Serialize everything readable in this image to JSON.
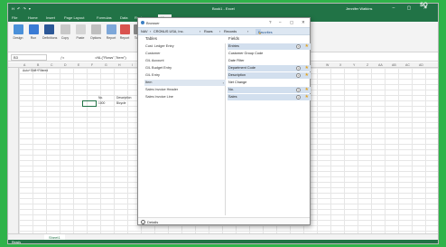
{
  "excel": {
    "title_doc": "Book1 - Excel",
    "title_user": "Jennifer Watkins",
    "quick_access": "H ↶ ↷ ▾",
    "window_controls": "– ▢ ✕",
    "tabs": [
      "File",
      "Home",
      "Insert",
      "Page Layout",
      "Formulas",
      "Data",
      "Review",
      "View"
    ],
    "ribbon_buttons": [
      "Design",
      "Run",
      "Definitions",
      "Copy",
      "Paste",
      "Options",
      "Report",
      "Report",
      "Tools"
    ],
    "name_box": "B3",
    "formula": "=NL(\"Rows\",\"Item\")",
    "columns": [
      "A",
      "B",
      "C",
      "D",
      "E",
      "F",
      "G",
      "H",
      "I",
      "J",
      "K",
      "L",
      "M",
      "N",
      "O",
      "P",
      "Q",
      "R",
      "S",
      "T",
      "U",
      "V",
      "W",
      "X",
      "Y",
      "Z",
      "AA",
      "AB",
      "AC",
      "AD",
      "AE"
    ],
    "cells": [
      {
        "text": "Auto+Shift+Filtered",
        "row": "r1a"
      },
      {
        "text": "No.",
        "row": "r2"
      },
      {
        "text": "Description",
        "row": "r2b"
      },
      {
        "text": "1000",
        "row": "r3"
      },
      {
        "text": "Bicycle",
        "row": "r3b"
      }
    ],
    "sheet_tab": "Sheet1",
    "status": "Ready"
  },
  "dialog": {
    "title": "Browser",
    "controls": [
      "?",
      "–",
      "▢",
      "✕"
    ],
    "crumbs": [
      "NAV",
      "CRONUS USA, Inc.",
      "Rows",
      "Records"
    ],
    "favorites_label": "Favorites",
    "tables_header": "Tables",
    "fields_header": "Fields",
    "tables": [
      "Cust. Ledger Entry",
      "Customer",
      "G/L Account",
      "G/L Budget Entry",
      "G/L Entry",
      "Item",
      "Sales Invoice Header",
      "Sales Invoice Line"
    ],
    "selected_table_index": 5,
    "fields": [
      {
        "label": "Entries",
        "badge": "",
        "highlight": true,
        "circle": "+",
        "star": true
      },
      {
        "label": "Customer Group Code",
        "badge": "",
        "highlight": false,
        "circle": "",
        "star": false
      },
      {
        "label": "Date Filter",
        "badge": "",
        "highlight": false,
        "circle": "",
        "star": false
      },
      {
        "label": "Department Code",
        "badge": "",
        "highlight": true,
        "circle": "+",
        "star": true
      },
      {
        "label": "Description",
        "badge": "",
        "highlight": true,
        "circle": "+",
        "star": true
      },
      {
        "label": "Net Change",
        "badge": "",
        "highlight": false,
        "circle": "",
        "star": false
      },
      {
        "label": "No.",
        "badge": "",
        "highlight": true,
        "circle": "+",
        "star": true
      },
      {
        "label": "Sales",
        "badge": "",
        "highlight": true,
        "circle": "+",
        "star": true
      }
    ],
    "footer_label": "Details"
  },
  "corner_logo": "SQ"
}
